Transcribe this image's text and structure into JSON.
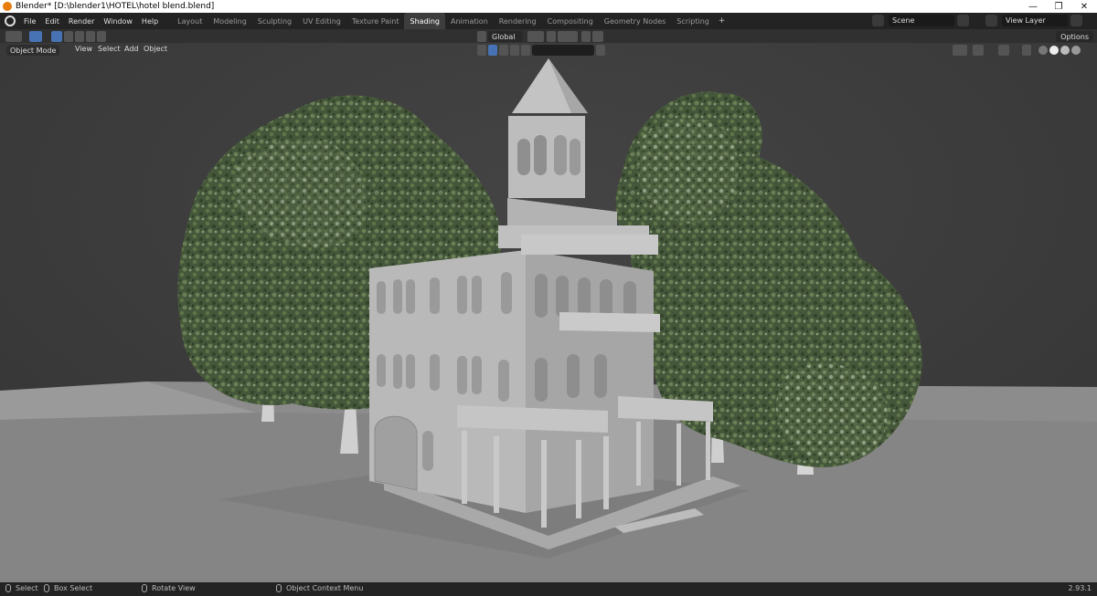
{
  "window": {
    "title": "Blender* [D:\\blender1\\HOTEL\\hotel blend.blend]",
    "minimize": "—",
    "maximize": "❐",
    "close": "✕"
  },
  "menu": {
    "items": [
      "File",
      "Edit",
      "Render",
      "Window",
      "Help"
    ]
  },
  "workspaces": {
    "tabs": [
      "Layout",
      "Modeling",
      "Sculpting",
      "UV Editing",
      "Texture Paint",
      "Shading",
      "Animation",
      "Rendering",
      "Compositing",
      "Geometry Nodes",
      "Scripting"
    ],
    "active": "Shading",
    "add_label": "+"
  },
  "scene": {
    "scene_name": "Scene",
    "view_layer": "View Layer"
  },
  "tool_header": {
    "orientation": "Global",
    "options_label": "Options"
  },
  "viewport_header": {
    "mode": "Object Mode",
    "menus": [
      "View",
      "Select",
      "Add",
      "Object"
    ]
  },
  "status": {
    "select": "Select",
    "box_select": "Box Select",
    "rotate_view": "Rotate View",
    "context_menu": "Object Context Menu",
    "version": "2.93.1"
  },
  "colors": {
    "accent": "#4772b3",
    "active_tab_bg": "#3d3d3d",
    "topbar_bg": "#232323",
    "viewport_bg": "#3d3d3d",
    "ground": "#8a8a8a",
    "foliage": "#4b5e3b"
  }
}
